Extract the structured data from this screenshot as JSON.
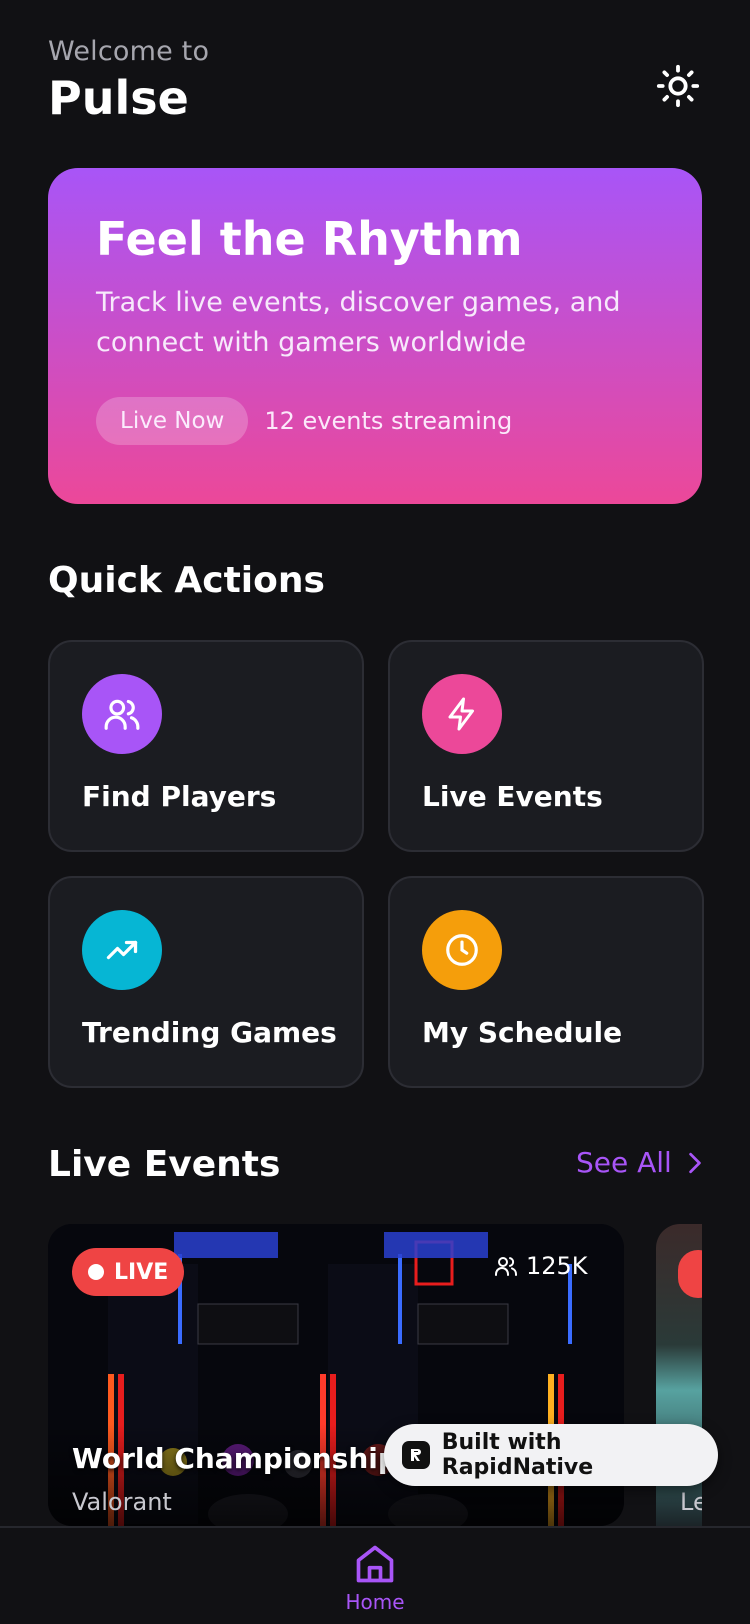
{
  "header": {
    "welcome": "Welcome to",
    "app_name": "Pulse",
    "theme_icon": "sun-icon"
  },
  "hero": {
    "title": "Feel the Rhythm",
    "subtitle": "Track live events, discover games, and connect with gamers worldwide",
    "live_label": "Live Now",
    "events_streaming": "12 events streaming",
    "gradient": [
      "#a855f7",
      "#ec4899"
    ]
  },
  "quick_actions": {
    "title": "Quick Actions",
    "items": [
      {
        "label": "Find Players",
        "icon": "users-icon",
        "color": "#a855f7"
      },
      {
        "label": "Live Events",
        "icon": "lightning-icon",
        "color": "#ec4899"
      },
      {
        "label": "Trending Games",
        "icon": "trending-up-icon",
        "color": "#06b6d4"
      },
      {
        "label": "My Schedule",
        "icon": "clock-icon",
        "color": "#f59e0b"
      }
    ]
  },
  "live_events": {
    "title": "Live Events",
    "see_all": "See All",
    "events": [
      {
        "badge": "LIVE",
        "viewers": "125K",
        "title": "World Championship F",
        "game": "Valorant"
      },
      {
        "game": "Le"
      }
    ]
  },
  "built_with": "Built with RapidNative",
  "bottom_nav": {
    "home_label": "Home"
  },
  "colors": {
    "accent": "#a855f7",
    "live_red": "#ef4444",
    "background": "#111114"
  }
}
